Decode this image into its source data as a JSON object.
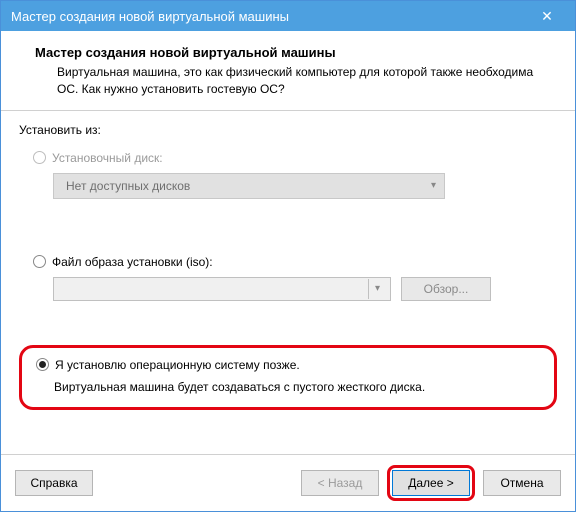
{
  "window": {
    "title": "Мастер создания новой виртуальной машины",
    "close_glyph": "✕"
  },
  "header": {
    "title": "Мастер создания новой виртуальной машины",
    "desc": "Виртуальная машина, это как физический компьютер для которой также необходима ОС. Как нужно установить гостевую ОС?"
  },
  "body": {
    "install_from_label": "Установить из:",
    "opt_disc_label": "Установочный диск:",
    "disc_dropdown_value": "Нет доступных дисков",
    "opt_iso_label": "Файл образа установки (iso):",
    "iso_path_value": "",
    "browse_label": "Обзор...",
    "opt_later_label": "Я установлю операционную систему позже.",
    "opt_later_sub": "Виртуальная машина будет создаваться с пустого жесткого диска."
  },
  "footer": {
    "help_label": "Справка",
    "back_label": "< Назад",
    "next_label": "Далее >",
    "cancel_label": "Отмена"
  },
  "colors": {
    "titlebar_bg": "#4da0e0",
    "highlight_border": "#e30613",
    "default_button_border": "#0078d7"
  }
}
